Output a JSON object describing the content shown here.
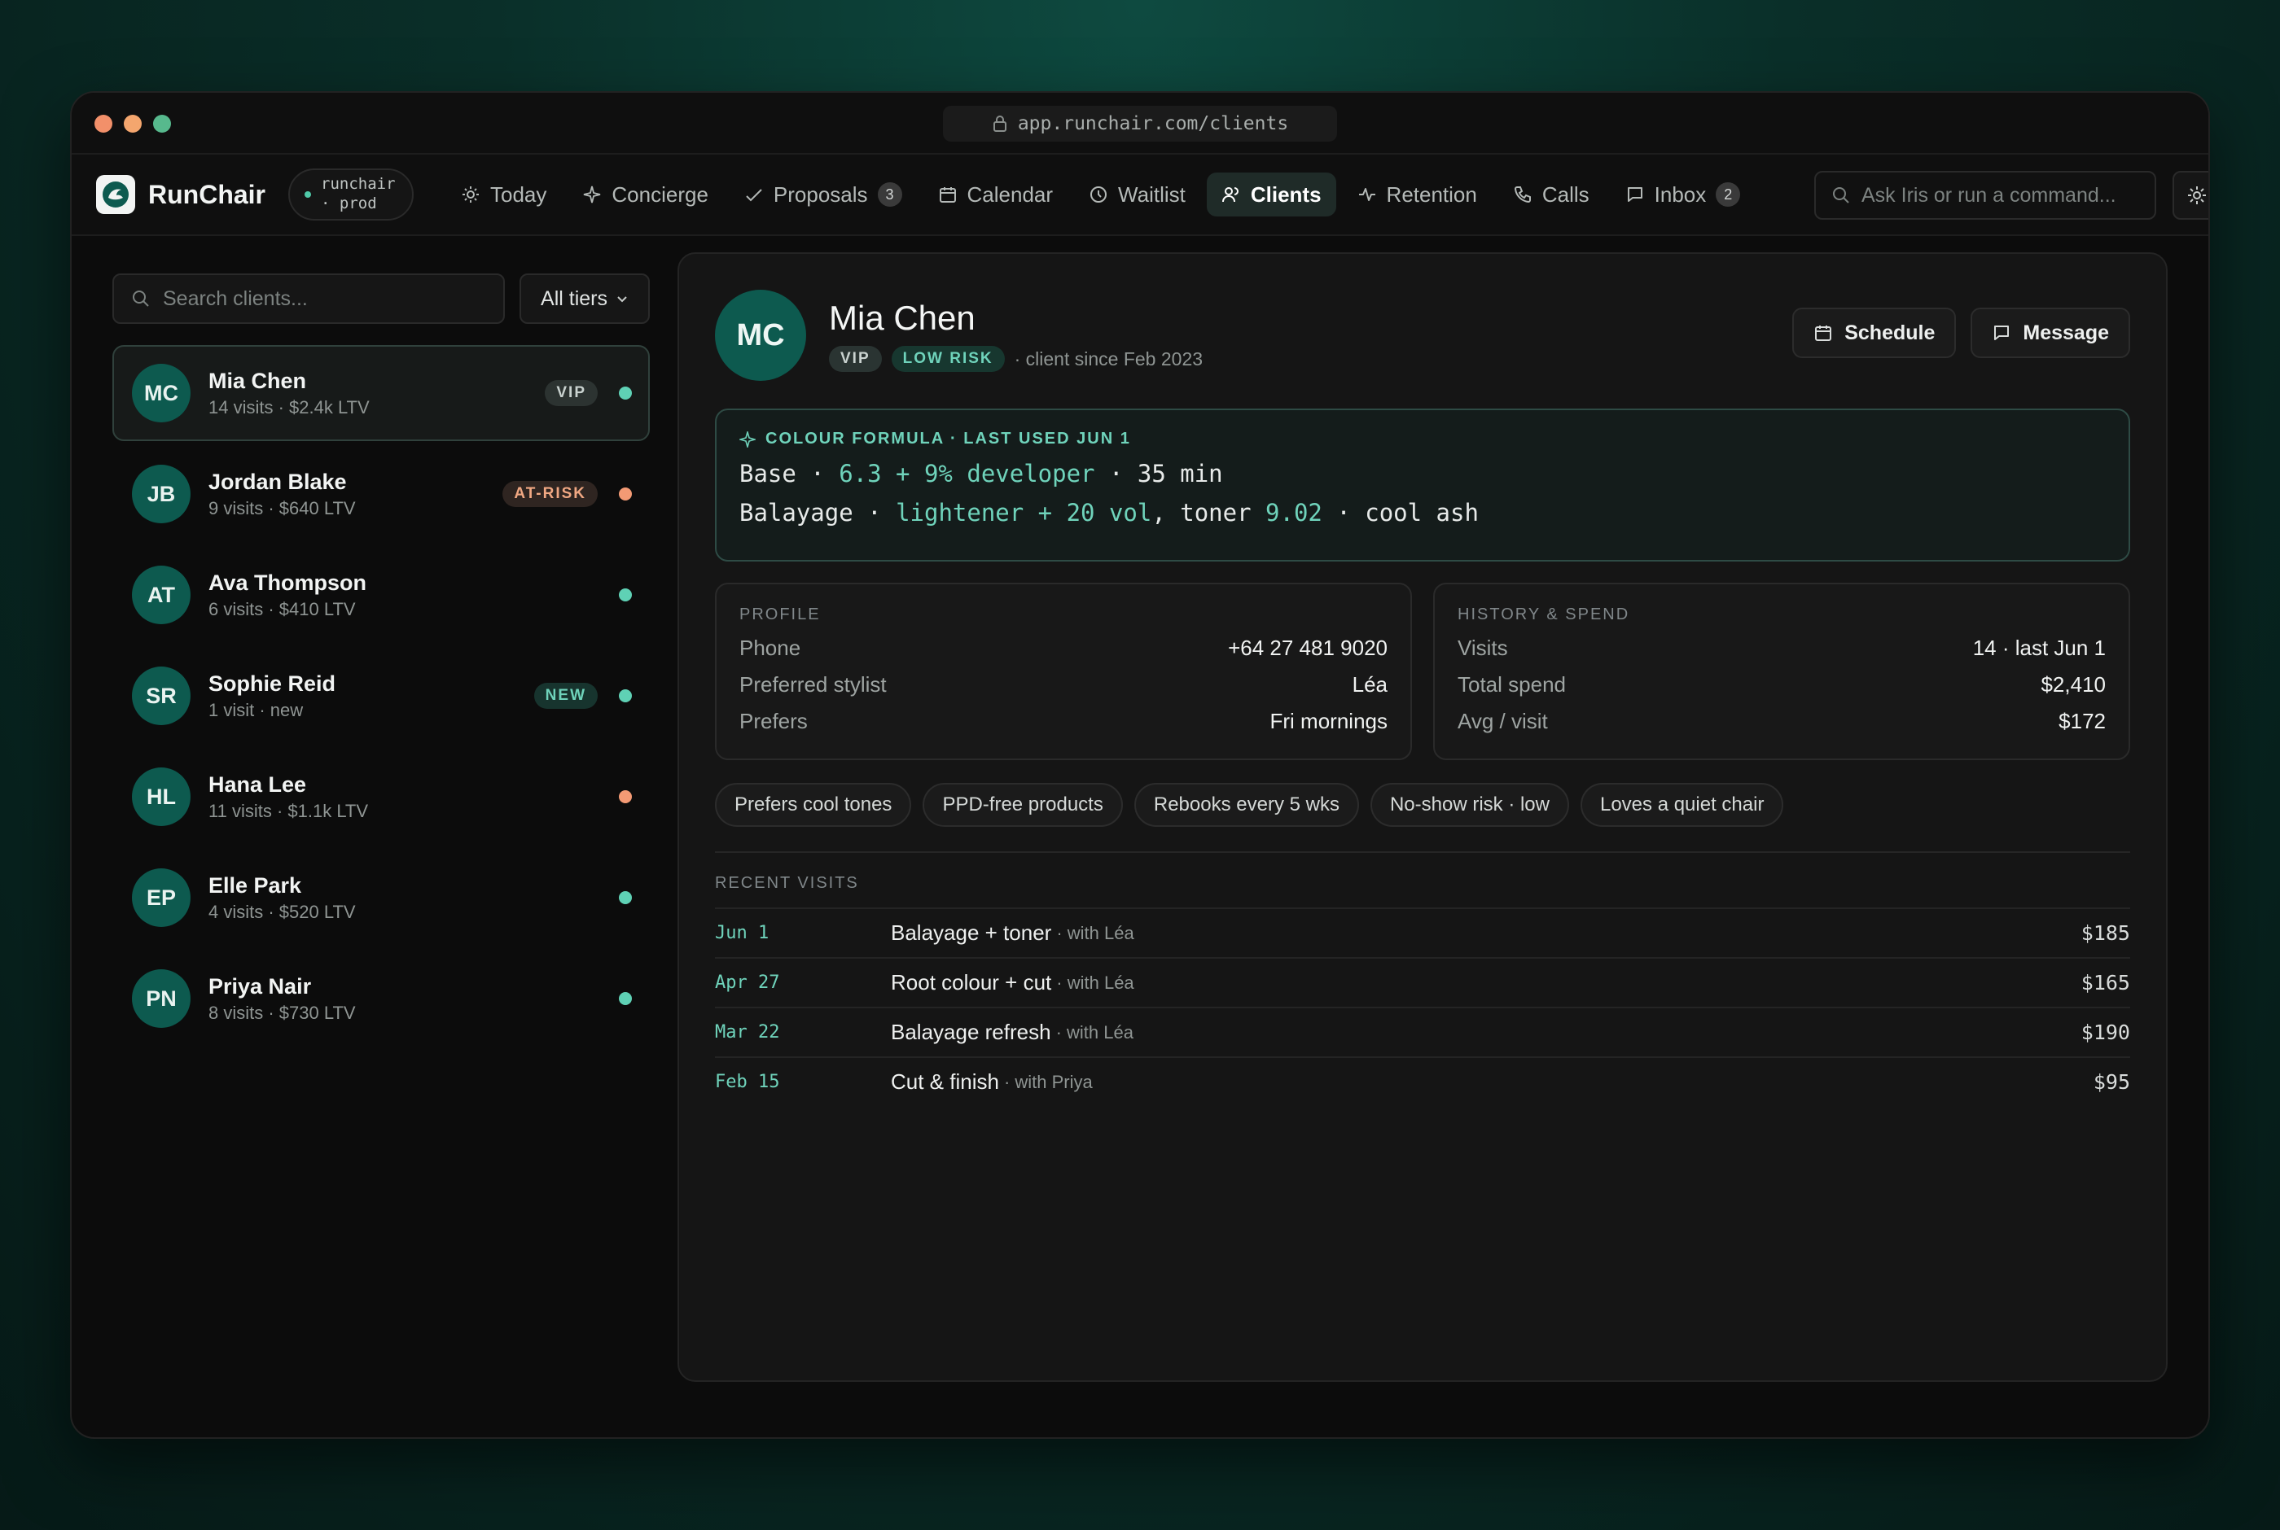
{
  "browser": {
    "url": "app.runchair.com/clients"
  },
  "brand": {
    "name": "RunChair",
    "env": "runchair · prod"
  },
  "nav": [
    {
      "label": "Today",
      "icon": "sun-icon"
    },
    {
      "label": "Concierge",
      "icon": "sparkle-icon"
    },
    {
      "label": "Proposals",
      "icon": "check-icon",
      "count": "3"
    },
    {
      "label": "Calendar",
      "icon": "calendar-icon"
    },
    {
      "label": "Waitlist",
      "icon": "clock-icon"
    },
    {
      "label": "Clients",
      "icon": "users-icon",
      "active": true
    },
    {
      "label": "Retention",
      "icon": "pulse-icon"
    },
    {
      "label": "Calls",
      "icon": "phone-icon"
    },
    {
      "label": "Inbox",
      "icon": "message-icon",
      "count": "2"
    }
  ],
  "command": {
    "placeholder": "Ask Iris or run a command..."
  },
  "sidebar": {
    "search_placeholder": "Search clients...",
    "tier_filter": "All tiers",
    "clients": [
      {
        "initials": "MC",
        "name": "Mia Chen",
        "meta": "14 visits · $2.4k LTV",
        "badge": "VIP",
        "status_color": "#5fd1b5",
        "selected": true
      },
      {
        "initials": "JB",
        "name": "Jordan Blake",
        "meta": "9 visits · $640 LTV",
        "badge": "AT-RISK",
        "status_color": "#f39a74"
      },
      {
        "initials": "AT",
        "name": "Ava Thompson",
        "meta": "6 visits · $410 LTV",
        "badge": "",
        "status_color": "#5fd1b5"
      },
      {
        "initials": "SR",
        "name": "Sophie Reid",
        "meta": "1 visit · new",
        "badge": "NEW",
        "status_color": "#5fd1b5"
      },
      {
        "initials": "HL",
        "name": "Hana Lee",
        "meta": "11 visits · $1.1k LTV",
        "badge": "",
        "status_color": "#f39a74"
      },
      {
        "initials": "EP",
        "name": "Elle Park",
        "meta": "4 visits · $520 LTV",
        "badge": "",
        "status_color": "#5fd1b5"
      },
      {
        "initials": "PN",
        "name": "Priya Nair",
        "meta": "8 visits · $730 LTV",
        "badge": "",
        "status_color": "#5fd1b5"
      }
    ]
  },
  "detail": {
    "initials": "MC",
    "name": "Mia Chen",
    "tags": [
      "VIP",
      "LOW RISK"
    ],
    "since": "· client since Feb 2023",
    "actions": {
      "schedule": "Schedule",
      "message": "Message"
    },
    "formula": {
      "header": "COLOUR FORMULA · LAST USED JUN 1",
      "line1": [
        {
          "t": "Base · ",
          "accent": false
        },
        {
          "t": "6.3 + 9% developer",
          "accent": true
        },
        {
          "t": " · 35 min",
          "accent": false
        }
      ],
      "line2": [
        {
          "t": "Balayage · ",
          "accent": false
        },
        {
          "t": "lightener + 20 vol",
          "accent": true
        },
        {
          "t": ", toner ",
          "accent": false
        },
        {
          "t": "9.02",
          "accent": true
        },
        {
          "t": " · cool ash",
          "accent": false
        }
      ]
    },
    "profile": {
      "title": "PROFILE",
      "rows": [
        {
          "k": "Phone",
          "v": "+64 27 481 9020"
        },
        {
          "k": "Preferred stylist",
          "v": "Léa"
        },
        {
          "k": "Prefers",
          "v": "Fri mornings"
        }
      ]
    },
    "history": {
      "title": "HISTORY & SPEND",
      "rows": [
        {
          "k": "Visits",
          "v": "14 · last Jun 1"
        },
        {
          "k": "Total spend",
          "v": "$2,410"
        },
        {
          "k": "Avg / visit",
          "v": "$172"
        }
      ]
    },
    "notes": [
      "Prefers cool tones",
      "PPD-free products",
      "Rebooks every 5 wks",
      "No-show risk · low",
      "Loves a quiet chair"
    ],
    "visits_title": "RECENT VISITS",
    "visits": [
      {
        "date": "Jun 1",
        "service": "Balayage + toner",
        "with": "· with Léa",
        "price": "$185"
      },
      {
        "date": "Apr 27",
        "service": "Root colour + cut",
        "with": "· with Léa",
        "price": "$165"
      },
      {
        "date": "Mar 22",
        "service": "Balayage refresh",
        "with": "· with Léa",
        "price": "$190"
      },
      {
        "date": "Feb 15",
        "service": "Cut & finish",
        "with": "· with Priya",
        "price": "$95"
      }
    ]
  },
  "colors": {
    "accent": "#6fd3bb",
    "avatar": "#0d5a4f",
    "warning": "#f39a74"
  }
}
